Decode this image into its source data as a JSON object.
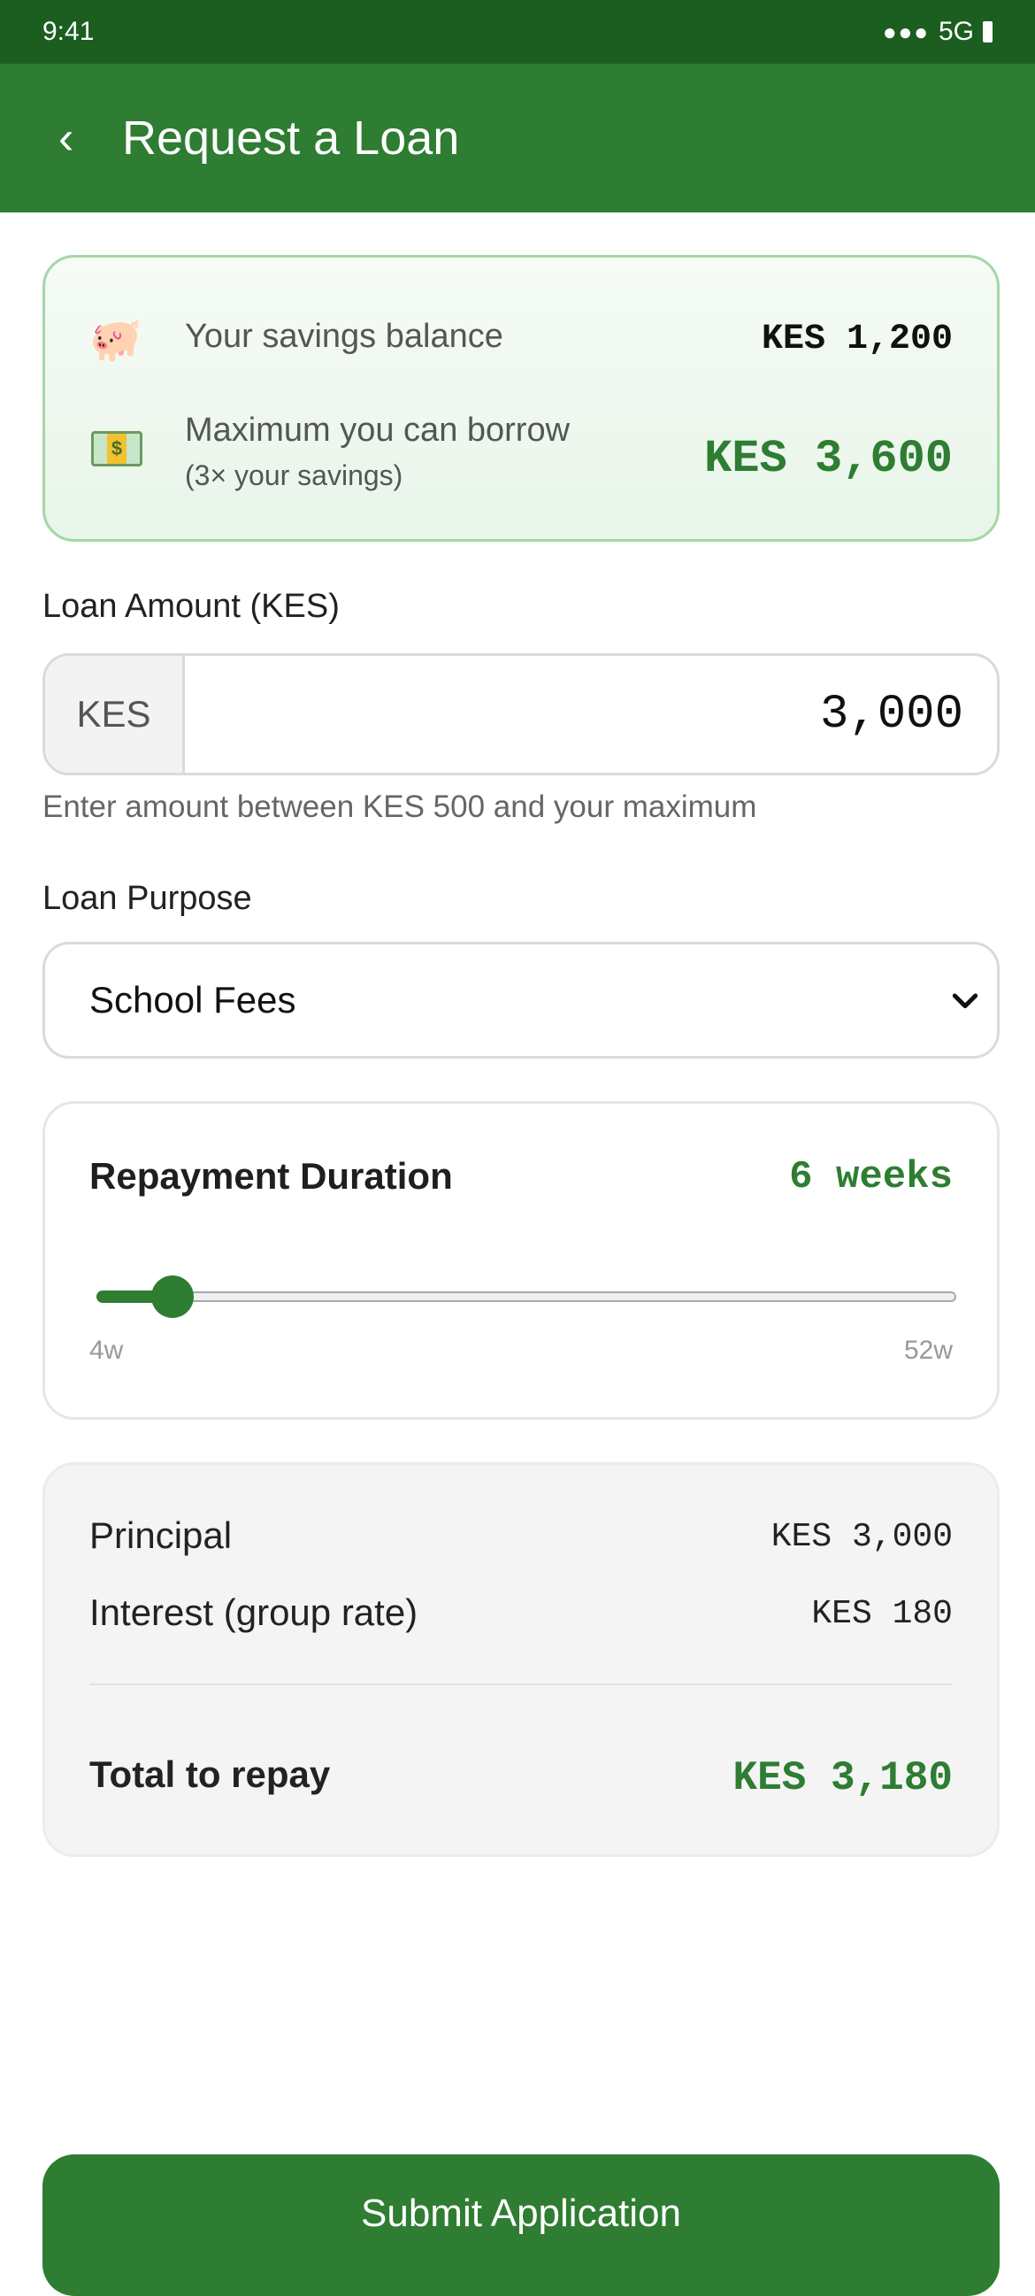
{
  "status_bar": {
    "time": "9:41",
    "signal": "●●●",
    "network": "5G"
  },
  "header": {
    "back_icon": "‹",
    "title": "Request a Loan"
  },
  "savings": {
    "balance_label": "Your savings balance",
    "balance_value": "KES 1,200",
    "max_label": "Maximum you can borrow",
    "max_sublabel": "(3× your savings)",
    "max_value": "KES 3,600",
    "pig_emoji": "🐖",
    "money_glyph": "$"
  },
  "loan_amount": {
    "label": "Loan Amount (KES)",
    "prefix": "KES",
    "value": "3,000",
    "hint": "Enter amount between KES 500 and your maximum"
  },
  "loan_purpose": {
    "label": "Loan Purpose",
    "selected": "School Fees"
  },
  "duration": {
    "title": "Repayment Duration",
    "value_label": "6 weeks",
    "min_label": "4w",
    "max_label": "52w",
    "min": 4,
    "max": 52,
    "current": 6
  },
  "summary": {
    "principal_label": "Principal",
    "principal_value": "KES 3,000",
    "interest_label": "Interest (group rate)",
    "interest_value": "KES 180",
    "total_label": "Total to repay",
    "total_value": "KES 3,180"
  },
  "submit": {
    "label": "Submit Application"
  },
  "colors": {
    "primary": "#2e7d32",
    "primary_dark": "#1b5e20",
    "card_border": "#a5d6a7"
  }
}
